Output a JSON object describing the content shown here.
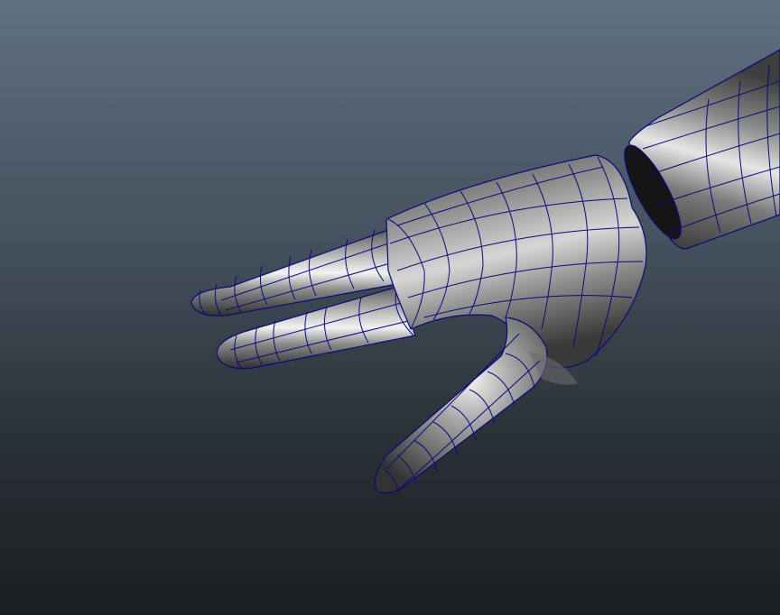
{
  "viewport": {
    "background_top": "#5f7081",
    "background_bottom": "#1b1e21",
    "wireframe_color": "#0b0a7a",
    "surface_color": "#7e7e7e"
  },
  "scene": {
    "objects": [
      "hand-mesh",
      "forearm-mesh"
    ]
  }
}
